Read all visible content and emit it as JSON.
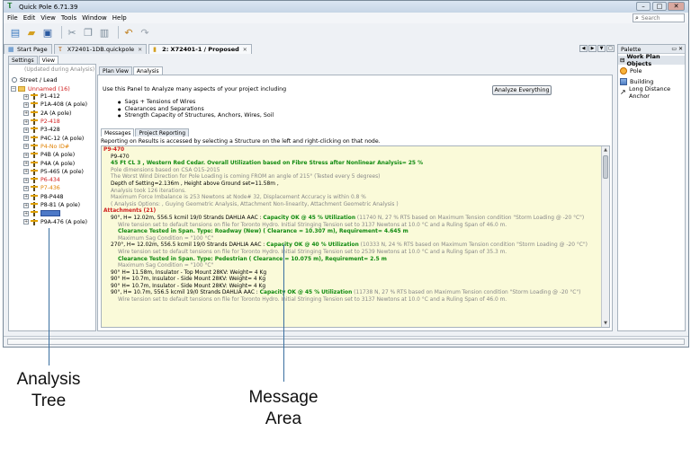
{
  "app": {
    "title": "Quick Pole 6.71.39",
    "menu": [
      "File",
      "Edit",
      "View",
      "Tools",
      "Window",
      "Help"
    ],
    "search_placeholder": "Search"
  },
  "doc_tabs": [
    {
      "label": "Start Page",
      "active": false
    },
    {
      "label": "X72401-1DB.quickpole",
      "active": false
    },
    {
      "label": "2: X72401-1 / Proposed",
      "active": true
    }
  ],
  "palette": {
    "title": "Palette",
    "section": "Work Plan Objects",
    "items": [
      {
        "label": "Pole",
        "icon": "pole-icon"
      },
      {
        "label": "Building",
        "icon": "building-icon"
      },
      {
        "label": "Long Distance Anchor",
        "icon": "anchor-icon"
      }
    ]
  },
  "left": {
    "tabs": [
      "Settings",
      "View"
    ],
    "updated_note": "(Updated during Analysis)",
    "street_lead": "Street / Lead",
    "root": "Unnamed (16)",
    "nodes": [
      {
        "label": "P1-412",
        "color": "black"
      },
      {
        "label": "P1A-408 (A pole)",
        "color": "black"
      },
      {
        "label": "2A (A pole)",
        "color": "black"
      },
      {
        "label": "P2-418",
        "color": "red"
      },
      {
        "label": "P3-428",
        "color": "black"
      },
      {
        "label": "P4C-12 (A pole)",
        "color": "black"
      },
      {
        "label": "P4-No ID#",
        "color": "orange"
      },
      {
        "label": "P4B (A pole)",
        "color": "black"
      },
      {
        "label": "P4A (A pole)",
        "color": "black"
      },
      {
        "label": "P5-465 (A pole)",
        "color": "black"
      },
      {
        "label": "P6-434",
        "color": "red"
      },
      {
        "label": "P7-436",
        "color": "orange"
      },
      {
        "label": "P8-P448",
        "color": "black"
      },
      {
        "label": "P8-81 (A pole)",
        "color": "black"
      },
      {
        "label": "",
        "color": "editing"
      },
      {
        "label": "P9A-476 (A pole)",
        "color": "black"
      }
    ]
  },
  "analysis": {
    "sub_tabs": [
      "Plan View",
      "Analysis"
    ],
    "description": "Use this Panel to Analyze many aspects of your project including",
    "bullets": [
      "Sags + Tensions of Wires",
      "Clearances and Separations",
      "Strength Capacity of Structures, Anchors, Wires, Soil"
    ],
    "analyze_button": "Analyze Everything",
    "msg_tabs": [
      "Messages",
      "Project Reporting"
    ],
    "reporting_note": "Reporting on Results is accessed by selecting a Structure on the left and right-clicking on that node.",
    "messages": [
      {
        "indent": 0,
        "parts": [
          {
            "t": "P9-470",
            "c": "red"
          }
        ]
      },
      {
        "indent": 1,
        "parts": [
          {
            "t": "P9-470",
            "c": "black"
          }
        ]
      },
      {
        "indent": 1,
        "parts": [
          {
            "t": "45 Ft CL 3 , Western Red Cedar. Overall Utilization based on Fibre Stress after Nonlinear Analysis= 25 %",
            "c": "green"
          }
        ]
      },
      {
        "indent": 1,
        "parts": [
          {
            "t": "Pole dimensions based on CSA O15-2015",
            "c": "gray"
          }
        ]
      },
      {
        "indent": 1,
        "parts": [
          {
            "t": "The Worst Wind Direction for Pole Loading is coming FROM an angle of 215° (Tested every 5 degrees)",
            "c": "gray"
          }
        ]
      },
      {
        "indent": 1,
        "parts": [
          {
            "t": "Depth of Setting=2.136m , Height above Ground set=11.58m ,",
            "c": "black"
          }
        ]
      },
      {
        "indent": 1,
        "parts": [
          {
            "t": "Analysis took 126 iterations.",
            "c": "gray"
          }
        ]
      },
      {
        "indent": 1,
        "parts": [
          {
            "t": "Maximum Force Imbalance is 253 Newtons at Node# 32, Displacement Accuracy is within 0.8 %",
            "c": "gray"
          }
        ]
      },
      {
        "indent": 1,
        "parts": [
          {
            "t": "( Analysis Options: , Guying Geometric Analysis, Attachment Non-linearity, Attachment Geometric Analysis )",
            "c": "gray"
          }
        ]
      },
      {
        "indent": 0,
        "parts": [
          {
            "t": "Attachments (21)",
            "c": "red"
          }
        ]
      },
      {
        "indent": 1,
        "parts": [
          {
            "t": "90°, H= 12.02m, 556.5 kcmil 19/0 Strands DAHLIA AAC : ",
            "c": "black"
          },
          {
            "t": "Capacity OK @ 45 % Utilization",
            "c": "green"
          },
          {
            "t": " (11740 N, 27 % RTS based on Maximum Tension condition \"Storm Loading @ -20 °C\")",
            "c": "gray"
          }
        ]
      },
      {
        "indent": 2,
        "parts": [
          {
            "t": "Wire tension set to default tensions on file for Toronto Hydro. Initial Stringing Tension set to 3137 Newtons at 10.0 °C and a Ruling Span of 46.0 m.",
            "c": "gray"
          }
        ]
      },
      {
        "indent": 2,
        "parts": [
          {
            "t": "Clearance Tested in Span. Type: Roadway (New) ( Clearance = 10.307 m), Requirement= 4.645 m",
            "c": "green"
          }
        ]
      },
      {
        "indent": 2,
        "parts": [
          {
            "t": "Maximum Sag Condition = \"100 °C\"",
            "c": "gray"
          }
        ]
      },
      {
        "indent": 1,
        "parts": [
          {
            "t": "270°, H= 12.02m, 556.5 kcmil 19/0 Strands DAHLIA AAC : ",
            "c": "black"
          },
          {
            "t": "Capacity OK @ 40 % Utilization",
            "c": "green"
          },
          {
            "t": " (10333 N, 24 % RTS based on Maximum Tension condition \"Storm Loading @ -20 °C\")",
            "c": "gray"
          }
        ]
      },
      {
        "indent": 2,
        "parts": [
          {
            "t": "Wire tension set to default tensions on file for Toronto Hydro. Initial Stringing Tension set to 2539 Newtons at 10.0 °C and a Ruling Span of 35.3 m.",
            "c": "gray"
          }
        ]
      },
      {
        "indent": 2,
        "parts": [
          {
            "t": "Clearance Tested in Span. Type: Pedestrian ( Clearance = 10.075 m), Requirement= 2.5 m",
            "c": "green"
          }
        ]
      },
      {
        "indent": 2,
        "parts": [
          {
            "t": "Maximum Sag Condition = \"100 °C\"",
            "c": "gray"
          }
        ]
      },
      {
        "indent": 1,
        "parts": [
          {
            "t": "90° H= 11.58m, Insulator - Top Mount 28KV: Weight= 4 Kg",
            "c": "black"
          }
        ]
      },
      {
        "indent": 1,
        "parts": [
          {
            "t": "90° H= 10.7m, Insulator - Side Mount 28KV: Weight= 4 Kg",
            "c": "black"
          }
        ]
      },
      {
        "indent": 1,
        "parts": [
          {
            "t": "90° H= 10.7m, Insulator - Side Mount 28KV: Weight= 4 Kg",
            "c": "black"
          }
        ]
      },
      {
        "indent": 1,
        "parts": [
          {
            "t": "90°, H= 10.7m, 556.5 kcmil 19/0 Strands DAHLIA AAC : ",
            "c": "black"
          },
          {
            "t": "Capacity OK @ 45 % Utilization",
            "c": "green"
          },
          {
            "t": " (11738 N, 27 % RTS based on Maximum Tension condition \"Storm Loading @ -20 °C\")",
            "c": "gray"
          }
        ]
      },
      {
        "indent": 2,
        "parts": [
          {
            "t": "Wire tension set to default tensions on file for Toronto Hydro. Initial Stringing Tension set to 3137 Newtons at 10.0 °C and a Ruling Span of 46.0 m.",
            "c": "gray"
          }
        ]
      }
    ]
  },
  "annotations": {
    "tree_label": "Analysis\nTree",
    "message_label": "Message\nArea"
  },
  "colors": {
    "message_bg": "#fafad9",
    "annotation_line": "#3a6fa0"
  }
}
